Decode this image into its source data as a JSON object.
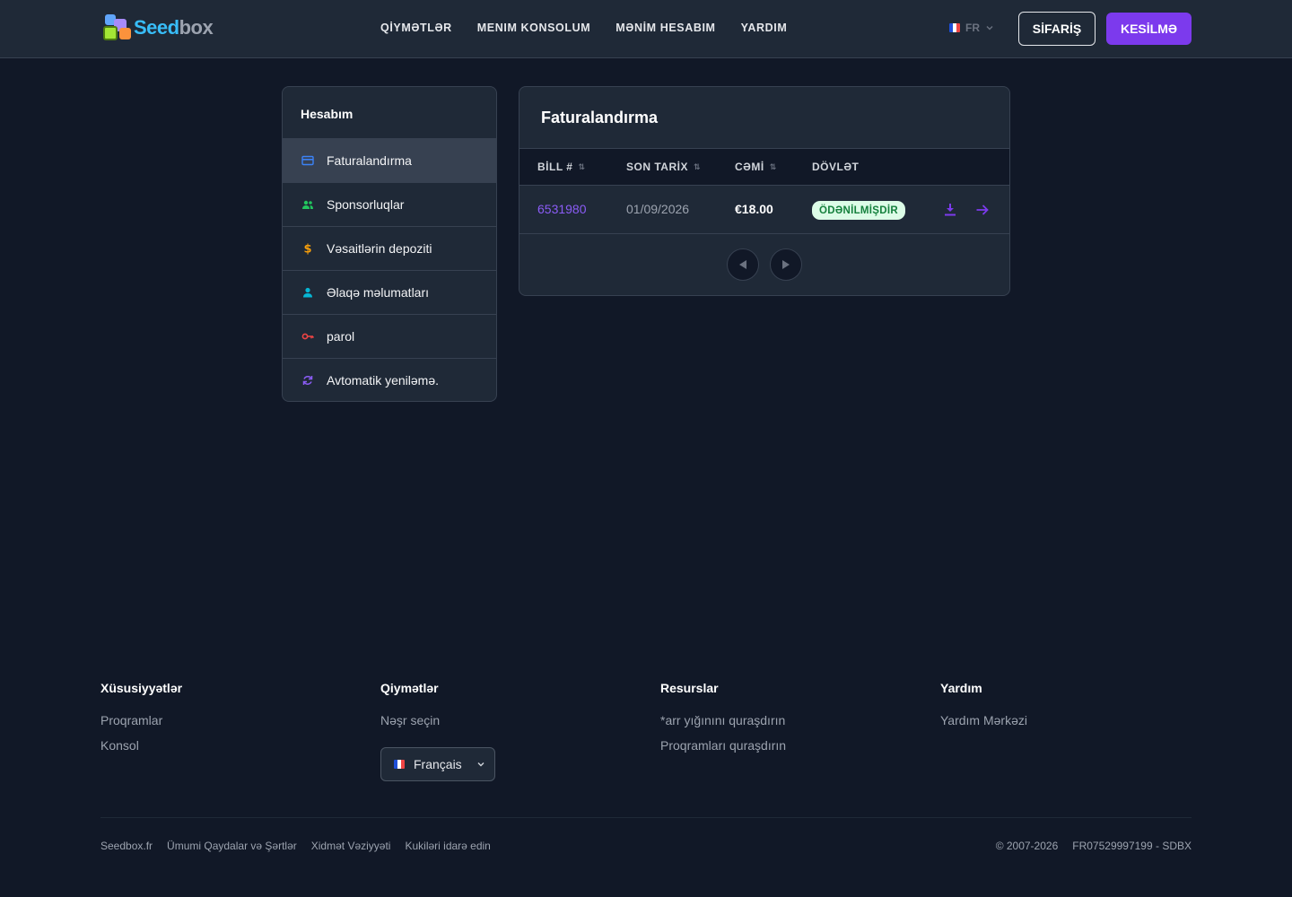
{
  "brand": {
    "name_part1": "Seed",
    "name_part2": "box"
  },
  "nav": {
    "items": [
      "QİYMƏTLƏR",
      "MENIM KONSOLUM",
      "MƏNİM HESABIM",
      "YARDIM"
    ]
  },
  "header": {
    "lang_code": "FR",
    "order_label": "SİFARİŞ",
    "logout_label": "KESİLMƏ"
  },
  "sidebar": {
    "title": "Hesabım",
    "items": [
      {
        "label": "Faturalandırma",
        "icon": "credit-card-icon",
        "color": "#3b82f6"
      },
      {
        "label": "Sponsorluqlar",
        "icon": "users-icon",
        "color": "#22c55e"
      },
      {
        "label": "Vəsaitlərin depoziti",
        "icon": "dollar-icon",
        "color": "#f59e0b"
      },
      {
        "label": "Əlaqə məlumatları",
        "icon": "user-icon",
        "color": "#06b6d4"
      },
      {
        "label": "parol",
        "icon": "key-icon",
        "color": "#ef4444"
      },
      {
        "label": "Avtomatik yeniləmə.",
        "icon": "refresh-icon",
        "color": "#8b5cf6"
      }
    ]
  },
  "billing": {
    "title": "Faturalandırma",
    "columns": [
      "BİLL #",
      "SON TARİX",
      "CƏMİ",
      "DÖVLƏT"
    ],
    "rows": [
      {
        "bill": "6531980",
        "due": "01/09/2026",
        "total": "€18.00",
        "status": "ÖDƏNİLMİŞDİR"
      }
    ]
  },
  "footer": {
    "col1": {
      "title": "Xüsusiyyətlər",
      "links": [
        "Proqramlar",
        "Konsol"
      ]
    },
    "col2": {
      "title": "Qiymətlər",
      "links": [
        "Nəşr seçin"
      ],
      "language": "Français"
    },
    "col3": {
      "title": "Resurslar",
      "links": [
        "*arr yığınını quraşdırın",
        "Proqramları quraşdırın"
      ]
    },
    "col4": {
      "title": "Yardım",
      "links": [
        "Yardım Mərkəzi"
      ]
    },
    "bottom_links": [
      "Seedbox.fr",
      "Ümumi Qaydalar və Şərtlər",
      "Xidmət Vəziyyəti",
      "Kukiləri idarə edin"
    ],
    "copyright": "© 2007-2026",
    "company_id": "FR07529997199 - SDBX"
  },
  "colors": {
    "accent": "#7c3aed",
    "link": "#8b5cf6",
    "paid_bg": "#dcfce7",
    "paid_text": "#15803d"
  }
}
